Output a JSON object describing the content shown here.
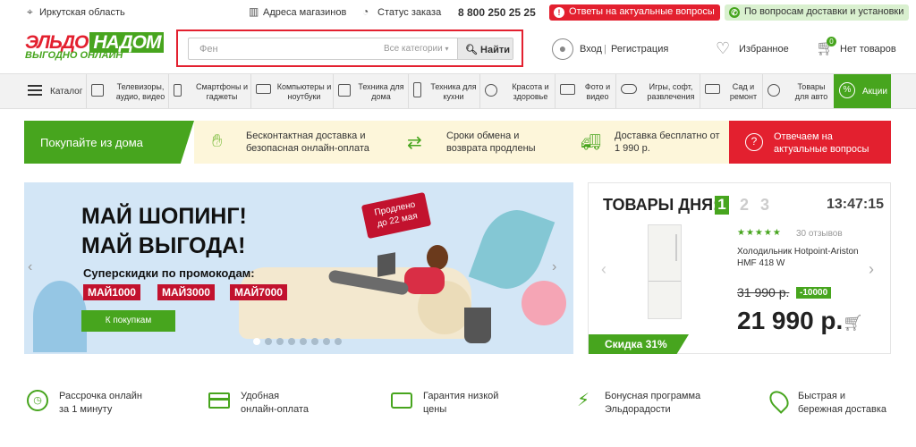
{
  "topbar": {
    "region": "Иркутская область",
    "stores": "Адреса магазинов",
    "order_status": "Статус заказа",
    "phone": "8 800 250 25 25",
    "alert": "Ответы на актуальные вопросы",
    "delivery": "По вопросам доставки и установки"
  },
  "logo": {
    "part1": "ЭЛЬДО",
    "part2": "НАДОМ",
    "tagline": "ВЫГОДНО ОНЛАЙН"
  },
  "search": {
    "placeholder": "Фен",
    "categories": "Все категории",
    "button": "Найти"
  },
  "header": {
    "login": "Вход",
    "separator": "|",
    "register": "Регистрация",
    "favorites": "Избранное",
    "cart_count": "0",
    "cart": "Нет товаров"
  },
  "catbar": {
    "catalog": "Каталог",
    "items": [
      "Телевизоры, аудио, видео",
      "Смартфоны и гаджеты",
      "Компьютеры и ноутбуки",
      "Техника для дома",
      "Техника для кухни",
      "Красота и здоровье",
      "Фото и видео",
      "Игры, софт, развлечения",
      "Сад и ремонт",
      "Товары для авто"
    ],
    "sale": "Акции"
  },
  "promo": {
    "main": "Покупайте из дома",
    "items": [
      "Бесконтактная доставка и безопасная онлайн-оплата",
      "Сроки обмена и возврата продлены",
      "Доставка бесплатно от 1 990 р."
    ],
    "alert": "Отвечаем на актуальные вопросы"
  },
  "banner": {
    "title1": "МАЙ ШОПИНГ!",
    "title2": "МАЙ ВЫГОДА!",
    "subtitle": "Суперскидки по промокодам:",
    "codes": [
      "МАЙ1000",
      "МАЙ3000",
      "МАЙ7000"
    ],
    "button": "К покупкам",
    "sticker1": "Продлено",
    "sticker2": "до 22 мая",
    "dots": 8
  },
  "deals": {
    "title": "ТОВАРЫ ДНЯ:",
    "pages": [
      "1",
      "2",
      "3"
    ],
    "timer": "13:47:15",
    "reviews": "30 отзывов",
    "rating": 5,
    "product1": "Холодильник Hotpoint-Ariston",
    "product2": "HMF 418 W",
    "old_price": "31 990 р.",
    "discount": "-10000",
    "price": "21 990 р.",
    "badge": "Скидка 31%"
  },
  "features": [
    {
      "line1": "Рассрочка онлайн",
      "line2": "за 1 минуту"
    },
    {
      "line1": "Удобная",
      "line2": "онлайн-оплата"
    },
    {
      "line1": "Гарантия низкой",
      "line2": "цены"
    },
    {
      "line1": "Бонусная программа",
      "line2": "Эльдорадости"
    },
    {
      "line1": "Быстрая и",
      "line2": "бережная доставка"
    }
  ],
  "colors": {
    "green": "#47a51e",
    "red": "#e3202f",
    "cream": "#fdf6da"
  }
}
